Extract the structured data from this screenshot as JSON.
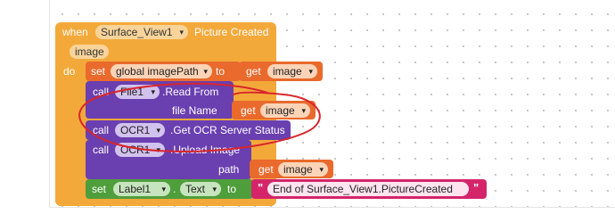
{
  "event_block": {
    "when_label": "when",
    "component": "Surface_View1",
    "event_name": "Picture Created",
    "param": "image",
    "do_label": "do"
  },
  "set_global": {
    "set_label": "set",
    "variable": "global imagePath",
    "to_label": "to",
    "get_label": "get",
    "get_value": "image"
  },
  "call_read": {
    "call_label": "call",
    "component": "File1",
    "method": ".Read From",
    "arg_label": "file Name",
    "get_label": "get",
    "get_value": "image"
  },
  "call_status": {
    "call_label": "call",
    "component": "OCR1",
    "method": ".Get OCR Server Status"
  },
  "call_upload": {
    "call_label": "call",
    "component": "OCR1",
    "method": ".Upload Image",
    "arg_label": "path",
    "get_label": "get",
    "get_value": "image"
  },
  "set_label_text": {
    "set_label": "set",
    "component": "Label1",
    "property": "Text",
    "to_label": "to",
    "string_value": "End of Surface_View1.PictureCreated"
  },
  "dropdown_arrow": "▾",
  "quote_glyph": "\"",
  "colors": {
    "event": "#f3a93a",
    "variables": "#e96a2c",
    "procedures_call": "#6a3fb0",
    "component_set": "#4f9e3c",
    "text": "#d4256b",
    "annotation": "#d9262b"
  }
}
